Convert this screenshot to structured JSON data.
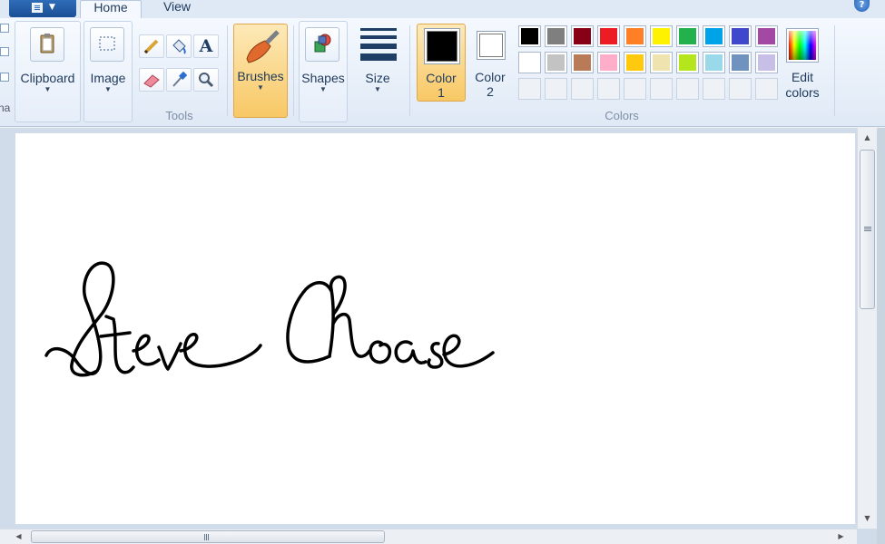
{
  "tabs": {
    "home": "Home",
    "view": "View"
  },
  "groups": {
    "clipboard": {
      "label": "Clipboard"
    },
    "image": {
      "label": "Image"
    },
    "tools": {
      "label": "Tools"
    },
    "brushes": {
      "label": "Brushes"
    },
    "shapes": {
      "label": "Shapes"
    },
    "size": {
      "label": "Size"
    },
    "colors": {
      "label": "Colors"
    }
  },
  "color1": {
    "label_line1": "Color",
    "label_line2": "1",
    "color": "#000000"
  },
  "color2": {
    "label_line1": "Color",
    "label_line2": "2",
    "color": "#ffffff"
  },
  "edit_colors": {
    "line1": "Edit",
    "line2": "colors"
  },
  "palette": {
    "row1": [
      "#000000",
      "#7f7f7f",
      "#880015",
      "#ed1c24",
      "#ff7f27",
      "#fff200",
      "#22b14c",
      "#00a2e8",
      "#3f48cc",
      "#a349a4"
    ],
    "row2": [
      "#ffffff",
      "#c3c3c3",
      "#b97a57",
      "#ffaec9",
      "#ffc90e",
      "#efe4b0",
      "#b5e61d",
      "#99d9ea",
      "#7092be",
      "#c8bfe7"
    ]
  },
  "canvas": {
    "ink_color": "#000000"
  },
  "left_strip": {
    "partial_label": "na"
  },
  "icons": {
    "app_menu": "app-menu-icon",
    "help": "help-icon",
    "clipboard": "clipboard-icon",
    "image_select": "selection-icon",
    "pencil": "pencil-icon",
    "fill": "fill-bucket-icon",
    "text": "text-icon",
    "eraser": "eraser-icon",
    "picker": "color-picker-icon",
    "magnifier": "magnifier-icon",
    "brushes": "brush-icon",
    "shapes": "shapes-icon",
    "size": "line-size-icon"
  }
}
